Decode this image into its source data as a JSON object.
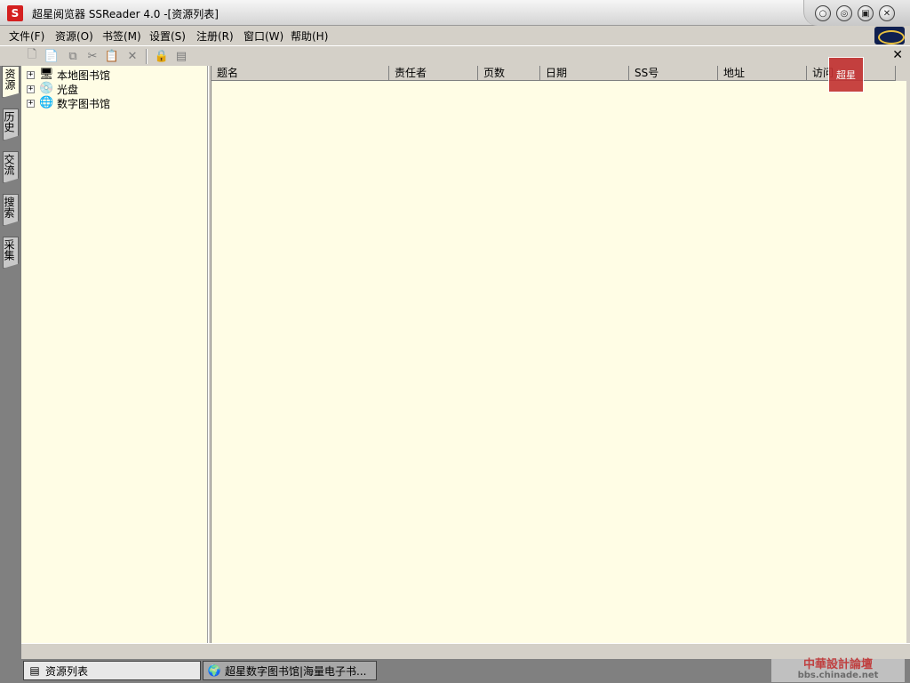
{
  "window": {
    "title": "超星阅览器 SSReader 4.0 -[资源列表]",
    "app_icon_text": "S",
    "buttons": [
      "○",
      "◎",
      "▣",
      "✕"
    ]
  },
  "menubar": {
    "items": [
      "文件(F)",
      "资源(O)",
      "书签(M)",
      "设置(S)",
      "注册(R)",
      "窗口(W)",
      "帮助(H)"
    ]
  },
  "toolbar": {
    "icons": [
      "new-icon",
      "paste-special-icon",
      "copy-icon",
      "cut-icon",
      "paste-icon",
      "delete-icon",
      "properties-icon",
      "view-icon"
    ],
    "glyphs": [
      "🗋",
      "📄",
      "⧉",
      "✂",
      "📋",
      "✕",
      "🔒",
      "▤"
    ],
    "close": "✕"
  },
  "side_tabs": [
    "资源",
    "历史",
    "交流",
    "搜索",
    "采集"
  ],
  "tree": {
    "items": [
      {
        "label": "本地图书馆",
        "icon": "computer-icon",
        "glyph": "🖥"
      },
      {
        "label": "光盘",
        "icon": "cd-icon",
        "glyph": "💿"
      },
      {
        "label": "数字图书馆",
        "icon": "network-library-icon",
        "glyph": "🌐"
      }
    ],
    "expander": "+"
  },
  "list": {
    "columns": [
      "题名",
      "责任者",
      "页数",
      "日期",
      "SS号",
      "地址",
      "访问"
    ],
    "corner_mark_text": "超星"
  },
  "taskbar": {
    "tasks": [
      {
        "label": "资源列表",
        "icon": "list-window-icon",
        "glyph": "▤"
      },
      {
        "label": "超星数字图书馆|海量电子书...",
        "icon": "globe-icon",
        "glyph": "🌍"
      }
    ]
  },
  "watermark": {
    "line1": "中華設計論壇",
    "line2": "bbs.chinade.net"
  }
}
